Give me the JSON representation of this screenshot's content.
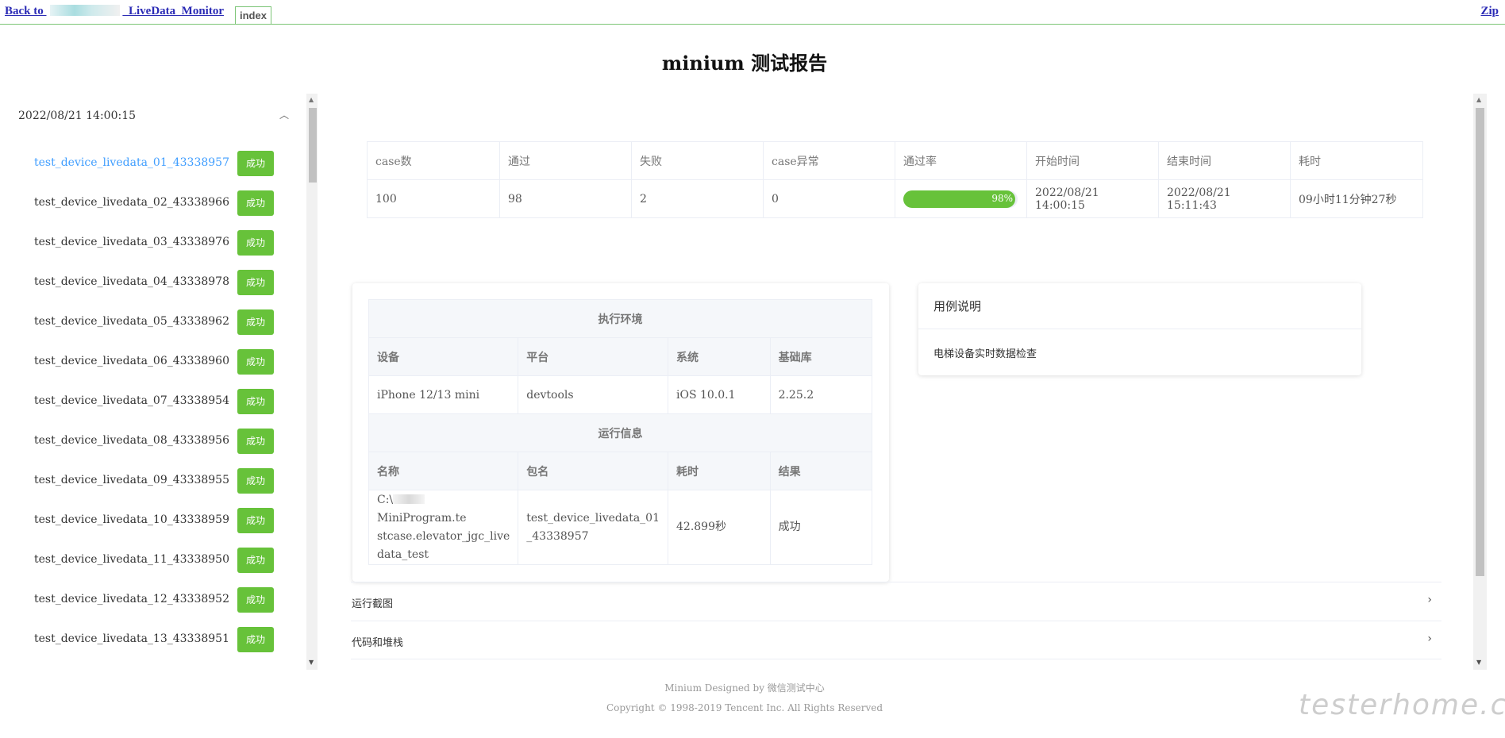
{
  "topbar": {
    "back_prefix": "Back to ",
    "back_suffix": "_LiveData_Monitor",
    "index_tab": "index",
    "zip_link": "Zip"
  },
  "page": {
    "title": "minium 测试报告"
  },
  "sidebar": {
    "group_date": "2022/08/21 14:00:15",
    "cases": [
      {
        "name": "test_device_livedata_01_43338957",
        "status": "成功"
      },
      {
        "name": "test_device_livedata_02_43338966",
        "status": "成功"
      },
      {
        "name": "test_device_livedata_03_43338976",
        "status": "成功"
      },
      {
        "name": "test_device_livedata_04_43338978",
        "status": "成功"
      },
      {
        "name": "test_device_livedata_05_43338962",
        "status": "成功"
      },
      {
        "name": "test_device_livedata_06_43338960",
        "status": "成功"
      },
      {
        "name": "test_device_livedata_07_43338954",
        "status": "成功"
      },
      {
        "name": "test_device_livedata_08_43338956",
        "status": "成功"
      },
      {
        "name": "test_device_livedata_09_43338955",
        "status": "成功"
      },
      {
        "name": "test_device_livedata_10_43338959",
        "status": "成功"
      },
      {
        "name": "test_device_livedata_11_43338950",
        "status": "成功"
      },
      {
        "name": "test_device_livedata_12_43338952",
        "status": "成功"
      },
      {
        "name": "test_device_livedata_13_43338951",
        "status": "成功"
      }
    ]
  },
  "summary": {
    "headers": [
      "case数",
      "通过",
      "失败",
      "case异常",
      "通过率",
      "开始时间",
      "结束时间",
      "耗时"
    ],
    "values": {
      "cases": "100",
      "passed": "98",
      "failed": "2",
      "errors": "0",
      "pass_rate_label": "98%",
      "pass_rate": 0.98,
      "start": "2022/08/21 14:00:15",
      "end": "2022/08/21 15:11:43",
      "duration": "09小时11分钟27秒"
    }
  },
  "env": {
    "section_env": "执行环境",
    "env_headers": [
      "设备",
      "平台",
      "系统",
      "基础库"
    ],
    "env_values": [
      "iPhone 12/13 mini",
      "devtools",
      "iOS 10.0.1",
      "2.25.2"
    ],
    "section_run": "运行信息",
    "run_headers": [
      "名称",
      "包名",
      "耗时",
      "结果"
    ],
    "run_name_prefix": "C:\\",
    "run_name_rest": "MiniProgram.te stcase.elevator_jgc_live data_test",
    "run_package": "test_device_livedata_01 _43338957",
    "run_duration": "42.899秒",
    "run_result": "成功"
  },
  "desc": {
    "title": "用例说明",
    "body": "电梯设备实时数据检查"
  },
  "collapse": {
    "screenshots": "运行截图",
    "code_stack": "代码和堆栈"
  },
  "footer": {
    "designed": "Minium Designed by 微信测试中心",
    "copyright": "Copyright © 1998-2019 Tencent Inc. All Rights Reserved"
  },
  "watermark": "testerhome.com",
  "colors": {
    "success": "#67c23a",
    "active_link": "#409eff",
    "link": "#2b2bb5",
    "topbar_border": "#7cc576"
  }
}
